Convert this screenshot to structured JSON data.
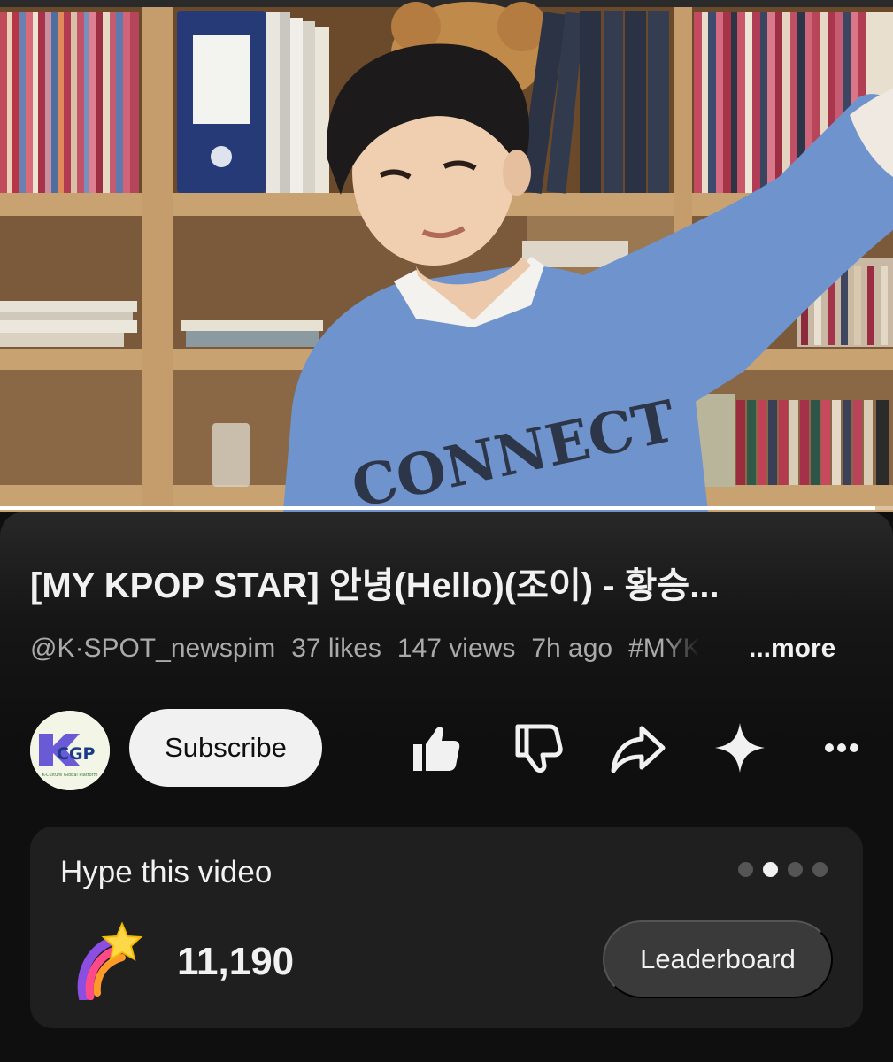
{
  "video": {
    "progress_fraction": 0.98,
    "sweater_text": "CONNECT"
  },
  "title": "[MY KPOP STAR] 안녕(Hello)(조이) - 황승...",
  "meta": {
    "channel": "@K·SPOT_newspim",
    "likes": "37 likes",
    "views": "147 views",
    "age": "7h ago",
    "hashtag": "#MYKPOPSTAR",
    "more": "...more"
  },
  "channel_avatar": {
    "logo_text": "KCGP",
    "logo_subtext": "K-Culture Global Platform"
  },
  "actions": {
    "subscribe_label": "Subscribe",
    "like_icon": "thumbs-up-icon",
    "dislike_icon": "thumbs-down-icon",
    "share_icon": "share-icon",
    "remix_icon": "sparkle-icon",
    "more_icon": "more-horizontal-icon"
  },
  "hype": {
    "title": "Hype this video",
    "count": "11,190",
    "leaderboard_label": "Leaderboard",
    "page_dots": 4,
    "active_dot": 1
  },
  "colors": {
    "background": "#0f0f0f",
    "card": "#1f1f1f",
    "text": "#f1f1f1",
    "secondary_text": "#aaaaaa",
    "subscribe_bg": "#f1f1f1",
    "sweater": "#6f93cc"
  }
}
